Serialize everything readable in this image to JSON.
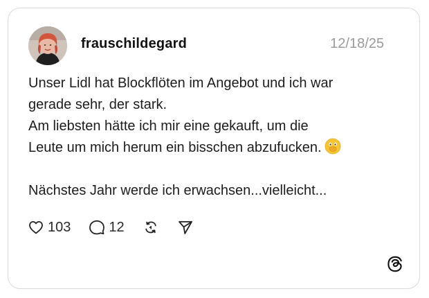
{
  "post": {
    "username": "frauschildegard",
    "date": "12/18/25",
    "lines": [
      "Unser Lidl hat Blockflöten im Angebot und ich war",
      "gerade sehr, der stark.",
      "Am liebsten hätte ich mir eine gekauft, um die",
      "Leute um mich herum ein bisschen abzufucken.",
      "",
      "Nächstes Jahr werde ich erwachsen...vielleicht..."
    ],
    "emoji": "face-with-open-eyes-and-hand-over-mouth-emoji"
  },
  "actions": {
    "likes": "103",
    "replies": "12"
  },
  "icons": {
    "like": "heart-icon",
    "reply": "comment-bubble-icon",
    "repost": "repost-icon",
    "share": "send-icon",
    "brand": "threads-logo-icon"
  },
  "colors": {
    "text": "#1c1c1c",
    "muted": "#9a9a9a",
    "border": "#d9d9d9",
    "emoji": "#f7c531"
  }
}
